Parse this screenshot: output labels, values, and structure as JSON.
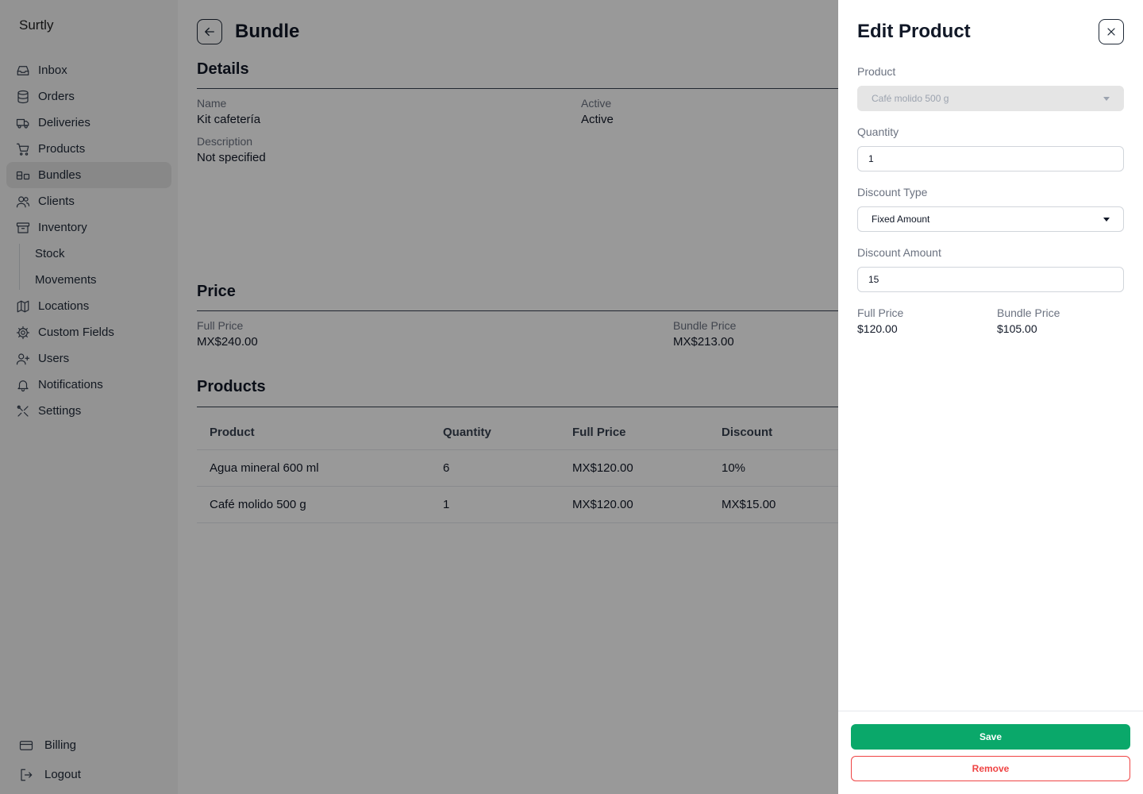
{
  "app": {
    "brand": "Surtly"
  },
  "sidebar": {
    "items": [
      {
        "label": "Inbox",
        "icon": "inbox-icon"
      },
      {
        "label": "Orders",
        "icon": "database-icon"
      },
      {
        "label": "Deliveries",
        "icon": "truck-icon"
      },
      {
        "label": "Products",
        "icon": "cart-icon"
      },
      {
        "label": "Bundles",
        "icon": "bundle-icon"
      },
      {
        "label": "Clients",
        "icon": "users-icon"
      },
      {
        "label": "Inventory",
        "icon": "archive-icon"
      }
    ],
    "inventory_sub": [
      {
        "label": "Stock"
      },
      {
        "label": "Movements"
      }
    ],
    "items_after": [
      {
        "label": "Locations",
        "icon": "map-icon"
      },
      {
        "label": "Custom Fields",
        "icon": "cog-icon"
      },
      {
        "label": "Users",
        "icon": "user-plus-icon"
      },
      {
        "label": "Notifications",
        "icon": "bell-icon"
      },
      {
        "label": "Settings",
        "icon": "tools-icon"
      }
    ],
    "bottom": [
      {
        "label": "Billing",
        "icon": "credit-card-icon"
      },
      {
        "label": "Logout",
        "icon": "logout-icon"
      }
    ],
    "active": "Bundles"
  },
  "page": {
    "title": "Bundle",
    "details": {
      "section_title": "Details",
      "name_label": "Name",
      "name_value": "Kit cafetería",
      "active_label": "Active",
      "active_value": "Active",
      "description_label": "Description",
      "description_value": "Not specified"
    },
    "price": {
      "section_title": "Price",
      "full_label": "Full Price",
      "full_value": "MX$240.00",
      "bundle_label": "Bundle Price",
      "bundle_value": "MX$213.00"
    },
    "products": {
      "section_title": "Products",
      "columns": [
        "Product",
        "Quantity",
        "Full Price",
        "Discount"
      ],
      "rows": [
        [
          "Agua mineral 600 ml",
          "6",
          "MX$120.00",
          "10%"
        ],
        [
          "Café molido 500 g",
          "1",
          "MX$120.00",
          "MX$15.00"
        ]
      ]
    }
  },
  "drawer": {
    "title": "Edit Product",
    "product_label": "Product",
    "product_value": "Café molido 500 g",
    "quantity_label": "Quantity",
    "quantity_value": "1",
    "discount_type_label": "Discount Type",
    "discount_type_value": "Fixed Amount",
    "discount_amount_label": "Discount Amount",
    "discount_amount_value": "15",
    "full_price_label": "Full Price",
    "full_price_value": "$120.00",
    "bundle_price_label": "Bundle Price",
    "bundle_price_value": "$105.00",
    "save_label": "Save",
    "remove_label": "Remove"
  },
  "colors": {
    "save": "#0aa86a",
    "remove": "#ef4444",
    "overlay": "rgba(0,0,0,0.40)"
  }
}
